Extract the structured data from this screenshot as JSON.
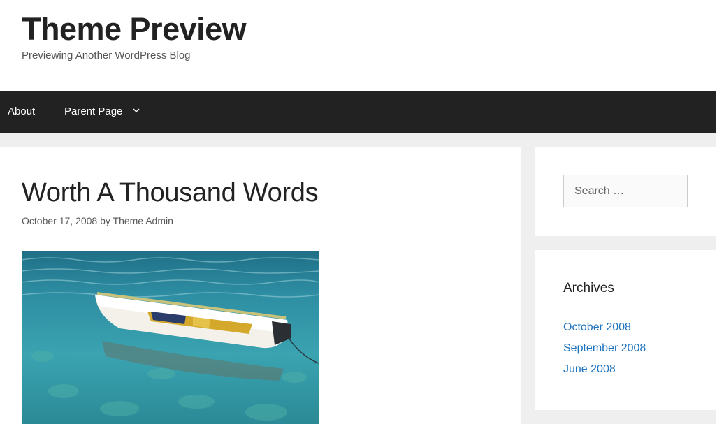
{
  "header": {
    "title": "Theme Preview",
    "description": "Previewing Another WordPress Blog"
  },
  "nav": {
    "items": [
      {
        "label": "About"
      },
      {
        "label": "Parent Page",
        "icon": "chevron-down-icon"
      }
    ]
  },
  "post": {
    "title": "Worth A Thousand Words",
    "date": "October 17, 2008",
    "by": "by",
    "author": "Theme Admin",
    "image": "rowboat-on-water-photo"
  },
  "sidebar": {
    "search": {
      "placeholder": "Search …"
    },
    "archives": {
      "title": "Archives",
      "items": [
        {
          "label": "October 2008"
        },
        {
          "label": "September 2008"
        },
        {
          "label": "June 2008"
        }
      ]
    }
  },
  "colors": {
    "nav_background": "#222222",
    "link": "#1e73be",
    "page_background": "#efefef"
  }
}
